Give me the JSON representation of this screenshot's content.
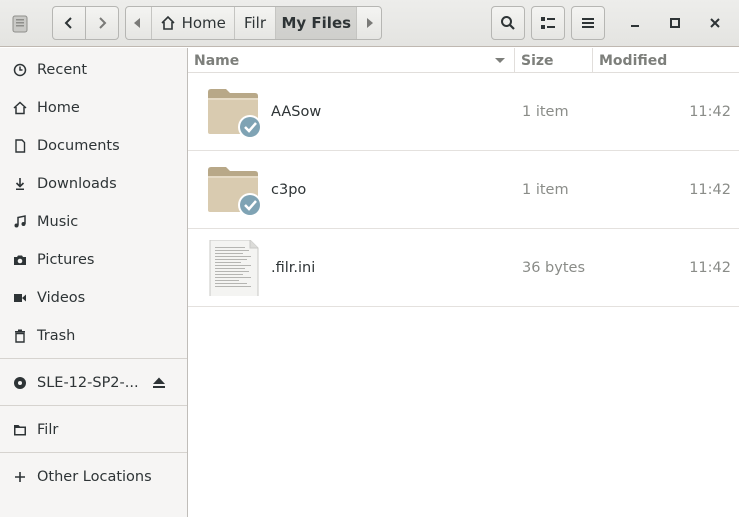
{
  "toolbar": {
    "app_icon": "drive-icon",
    "back_icon": "chevron-left-icon",
    "forward_icon": "chevron-right-icon",
    "search_icon": "search-icon",
    "view_icon": "list-view-icon",
    "menu_icon": "hamburger-icon"
  },
  "path": {
    "segments": [
      "Home",
      "Filr",
      "My Files"
    ],
    "active_index": 2
  },
  "window": {
    "minimize_icon": "minimize-icon",
    "maximize_icon": "maximize-icon",
    "close_icon": "close-icon"
  },
  "sidebar": {
    "places": [
      {
        "label": "Recent",
        "icon": "clock-icon"
      },
      {
        "label": "Home",
        "icon": "home-icon"
      },
      {
        "label": "Documents",
        "icon": "document-icon"
      },
      {
        "label": "Downloads",
        "icon": "download-icon"
      },
      {
        "label": "Music",
        "icon": "music-icon"
      },
      {
        "label": "Pictures",
        "icon": "camera-icon"
      },
      {
        "label": "Videos",
        "icon": "video-icon"
      },
      {
        "label": "Trash",
        "icon": "trash-icon"
      }
    ],
    "devices": [
      {
        "label": "SLE-12-SP2-...",
        "icon": "disc-icon",
        "eject_icon": "eject-icon"
      }
    ],
    "bookmarks": [
      {
        "label": "Filr",
        "icon": "folder-icon"
      }
    ],
    "other": {
      "label": "Other Locations",
      "icon": "plus-icon"
    }
  },
  "columns": {
    "name": "Name",
    "size": "Size",
    "modified": "Modified"
  },
  "files": [
    {
      "name": "AASow",
      "size": "1 item",
      "modified": "11:42",
      "type": "folder",
      "synced": true
    },
    {
      "name": "c3po",
      "size": "1 item",
      "modified": "11:42",
      "type": "folder",
      "synced": true
    },
    {
      "name": ".filr.ini",
      "size": "36 bytes",
      "modified": "11:42",
      "type": "text-file",
      "synced": false
    }
  ],
  "colors": {
    "sync_badge": "#7fa3b4",
    "folder": "#d7c8ac",
    "accent": "#2e3436"
  }
}
